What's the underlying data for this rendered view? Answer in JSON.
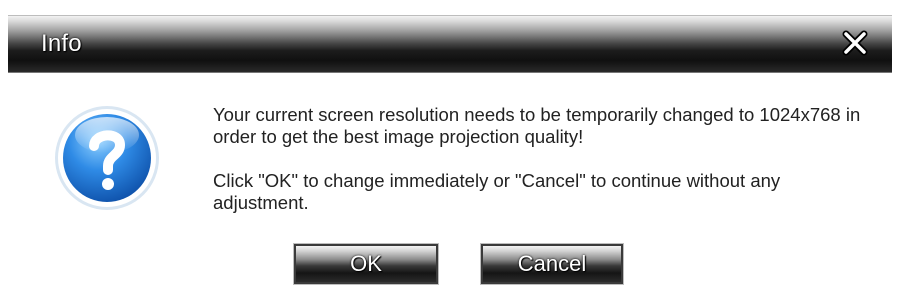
{
  "dialog": {
    "title": "Info",
    "close_icon": "close-x-icon",
    "icon": "question-mark-icon",
    "message_line1": "Your current screen resolution needs to be temporarily changed to 1024x768 in order to get the best image projection quality!",
    "message_line2": "Click \"OK\" to change immediately or \"Cancel\" to continue without any adjustment.",
    "ok_label": "OK",
    "cancel_label": "Cancel"
  },
  "colors": {
    "titlebar_dark": "#101010",
    "title_text": "#ffffff",
    "icon_blue": "#1f6fd1",
    "message_text": "#222222"
  }
}
